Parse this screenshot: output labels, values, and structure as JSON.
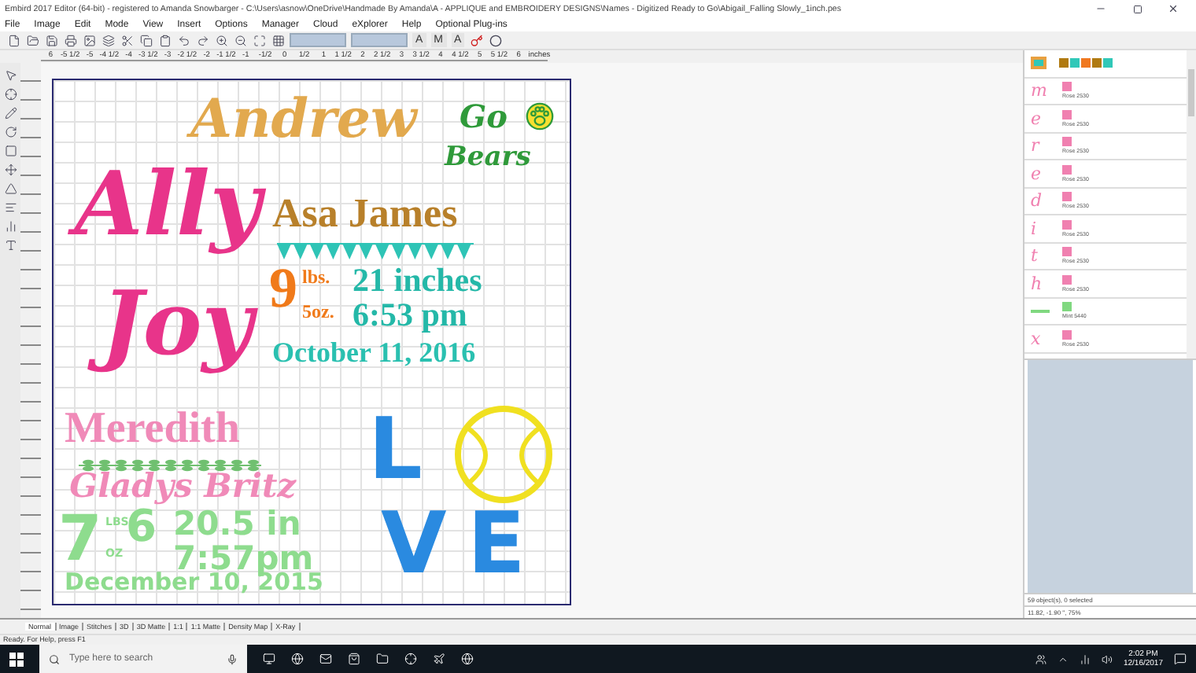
{
  "window": {
    "title": "Embird 2017 Editor (64-bit) - registered to Amanda Snowbarger - C:\\Users\\asnow\\OneDrive\\Handmade By Amanda\\A - APPLIQUE and EMBROIDERY DESIGNS\\Names - Digitized Ready to Go\\Abigail_Falling Slowly_1inch.pes"
  },
  "menu": [
    "File",
    "Image",
    "Edit",
    "Mode",
    "View",
    "Insert",
    "Options",
    "Manager",
    "Cloud",
    "eXplorer",
    "Help",
    "Optional Plug-ins"
  ],
  "toolbar": {
    "text_buttons": [
      "A",
      "M",
      "A"
    ]
  },
  "ruler": {
    "labels": [
      "6",
      "-5 1/2",
      "-5",
      "-4 1/2",
      "-4",
      "-3 1/2",
      "-3",
      "-2 1/2",
      "-2",
      "-1 1/2",
      "-1",
      "-1/2",
      "0",
      "1/2",
      "1",
      "1 1/2",
      "2",
      "2 1/2",
      "3",
      "3 1/2",
      "4",
      "4 1/2",
      "5",
      "5 1/2",
      "6"
    ],
    "unit": "inches"
  },
  "design": {
    "items": [
      {
        "text": "Andrew",
        "kind": "script",
        "color": "#e2a94e"
      },
      {
        "text": "Go",
        "kind": "script",
        "color": "#2f9a3a"
      },
      {
        "text": "Bears",
        "kind": "script",
        "color": "#2f9a3a"
      },
      {
        "text": "Ally",
        "kind": "script",
        "color": "#e8348a"
      },
      {
        "text": "Joy",
        "kind": "script",
        "color": "#e8348a"
      },
      {
        "text": "Asa James",
        "kind": "serif",
        "color": "#b8802a"
      },
      {
        "text": "9",
        "kind": "serif",
        "color": "#f07a1a"
      },
      {
        "text": "lbs.",
        "kind": "serif",
        "color": "#f07a1a"
      },
      {
        "text": "5oz.",
        "kind": "serif",
        "color": "#f07a1a"
      },
      {
        "text": "21 inches",
        "kind": "serif",
        "color": "#24b8a8"
      },
      {
        "text": "6:53 pm",
        "kind": "serif",
        "color": "#24b8a8"
      },
      {
        "text": "October 11, 2016",
        "kind": "serif",
        "color": "#2ac0b0"
      },
      {
        "text": "Meredith",
        "kind": "serif",
        "color": "#f08ab8"
      },
      {
        "text": "Gladys Britz",
        "kind": "script",
        "color": "#f08ab8"
      },
      {
        "text": "7",
        "kind": "block",
        "color": "#8edc8e"
      },
      {
        "text": "LBS",
        "kind": "block",
        "color": "#8edc8e"
      },
      {
        "text": "6",
        "kind": "block",
        "color": "#8edc8e"
      },
      {
        "text": "OZ",
        "kind": "block",
        "color": "#8edc8e"
      },
      {
        "text": "20.5 in",
        "kind": "block",
        "color": "#8edc8e"
      },
      {
        "text": "7:57pm",
        "kind": "block",
        "color": "#8edc8e"
      },
      {
        "text": "December 10, 2015",
        "kind": "block",
        "color": "#8edc8e"
      },
      {
        "text": "L",
        "kind": "block",
        "color": "#2a8ae0"
      },
      {
        "text": "V",
        "kind": "block",
        "color": "#2a8ae0"
      },
      {
        "text": "E",
        "kind": "block",
        "color": "#2a8ae0"
      }
    ]
  },
  "view_tabs": [
    {
      "label": "Normal",
      "selected": true
    },
    {
      "label": "Image",
      "selected": false
    },
    {
      "label": "Stitches",
      "selected": false
    },
    {
      "label": "3D",
      "selected": false
    },
    {
      "label": "3D Matte",
      "selected": false
    },
    {
      "label": "1:1",
      "selected": false
    },
    {
      "label": "1:1 Matte",
      "selected": false
    },
    {
      "label": "Density Map",
      "selected": false
    },
    {
      "label": "X-Ray",
      "selected": false
    }
  ],
  "objects": [
    {
      "kind": "group",
      "swatches": [
        {
          "color": "#b07a10"
        },
        {
          "color": "#30c8b8"
        },
        {
          "color": "#f07820"
        },
        {
          "color": "#b07a10"
        },
        {
          "color": "#30c8b8"
        }
      ]
    },
    {
      "kind": "letter",
      "preview": "m",
      "thread": "Rose 2530",
      "color": "#f080b0"
    },
    {
      "kind": "letter",
      "preview": "e",
      "thread": "Rose 2530",
      "color": "#f080b0"
    },
    {
      "kind": "letter",
      "preview": "r",
      "thread": "Rose 2530",
      "color": "#f080b0"
    },
    {
      "kind": "letter",
      "preview": "e",
      "thread": "Rose 2530",
      "color": "#f080b0"
    },
    {
      "kind": "letter",
      "preview": "d",
      "thread": "Rose 2530",
      "color": "#f080b0"
    },
    {
      "kind": "letter",
      "preview": "i",
      "thread": "Rose 2530",
      "color": "#f080b0"
    },
    {
      "kind": "letter",
      "preview": "t",
      "thread": "Rose 2530",
      "color": "#f080b0"
    },
    {
      "kind": "letter",
      "preview": "h",
      "thread": "Rose 2530",
      "color": "#f080b0"
    },
    {
      "kind": "line",
      "thread": "Mint 5440",
      "color": "#80d880"
    },
    {
      "kind": "letter",
      "preview": "x",
      "thread": "Rose 2530",
      "color": "#f080b0"
    }
  ],
  "panel_status": [
    "59 object(s), 0 selected",
    "11.82, -1.90 \", 75%"
  ],
  "status_bar": "Ready.  For Help, press F1",
  "taskbar": {
    "search_placeholder": "Type here to search",
    "time": "2:02 PM",
    "date": "12/16/2017"
  }
}
